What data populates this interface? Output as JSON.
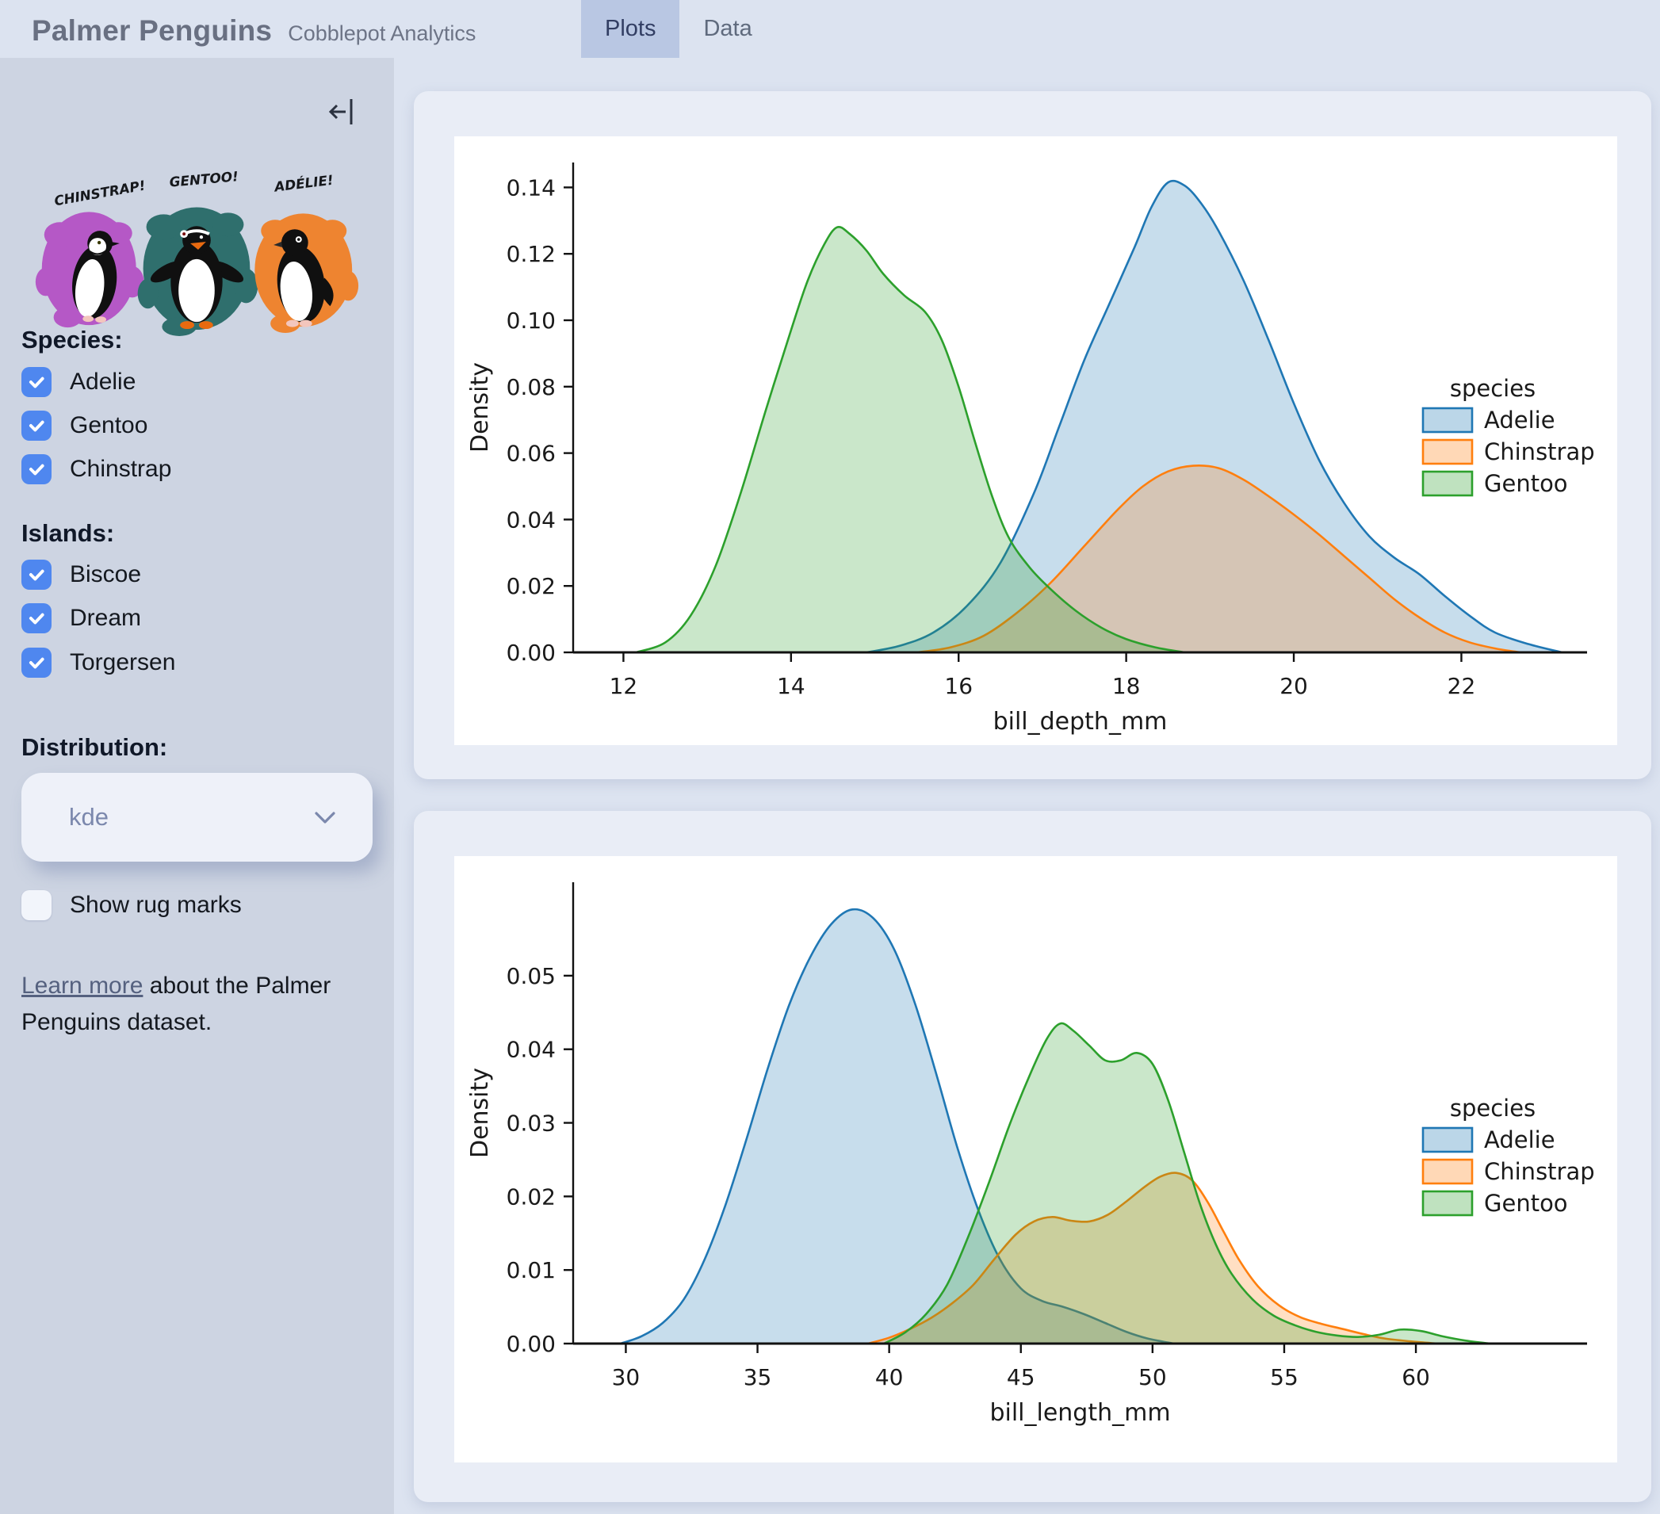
{
  "header": {
    "title": "Palmer Penguins",
    "subtitle": "Cobblepot Analytics",
    "tabs": [
      {
        "label": "Plots",
        "active": true
      },
      {
        "label": "Data",
        "active": false
      }
    ]
  },
  "sidebar": {
    "artwork": {
      "labels": [
        "CHINSTRAP!",
        "GENTOO!",
        "ADÉLIE!"
      ],
      "blob_colors": [
        "#b558c6",
        "#2f6f6d",
        "#ee8430"
      ]
    },
    "species": {
      "heading": "Species:",
      "options": [
        {
          "label": "Adelie",
          "checked": true
        },
        {
          "label": "Gentoo",
          "checked": true
        },
        {
          "label": "Chinstrap",
          "checked": true
        }
      ]
    },
    "islands": {
      "heading": "Islands:",
      "options": [
        {
          "label": "Biscoe",
          "checked": true
        },
        {
          "label": "Dream",
          "checked": true
        },
        {
          "label": "Torgersen",
          "checked": true
        }
      ]
    },
    "distribution": {
      "heading": "Distribution:",
      "value": "kde"
    },
    "rug": {
      "label": "Show rug marks",
      "checked": false
    },
    "footer": {
      "link_text": "Learn more",
      "rest": " about the Palmer Penguins dataset."
    }
  },
  "chart_data": [
    {
      "type": "area",
      "subtype": "kde",
      "xlabel": "bill_depth_mm",
      "ylabel": "Density",
      "xlim": [
        11.4,
        23.5
      ],
      "ylim": [
        0,
        0.1475
      ],
      "xticks": [
        12,
        14,
        16,
        18,
        20,
        22
      ],
      "yticks": [
        0.0,
        0.02,
        0.04,
        0.06,
        0.08,
        0.1,
        0.12,
        0.14
      ],
      "ytick_decimals": 2,
      "grid": false,
      "legend": {
        "title": "species",
        "position": "center-right",
        "entries": [
          {
            "label": "Adelie",
            "color": "#1f77b4"
          },
          {
            "label": "Chinstrap",
            "color": "#ff7f0e"
          },
          {
            "label": "Gentoo",
            "color": "#2ca02c"
          }
        ]
      },
      "series": [
        {
          "name": "Adelie",
          "color": "#1f77b4",
          "points": [
            [
              14.9,
              0
            ],
            [
              15.3,
              0.002
            ],
            [
              15.7,
              0.006
            ],
            [
              16.1,
              0.014
            ],
            [
              16.5,
              0.027
            ],
            [
              16.9,
              0.048
            ],
            [
              17.2,
              0.068
            ],
            [
              17.5,
              0.088
            ],
            [
              17.8,
              0.105
            ],
            [
              18.1,
              0.122
            ],
            [
              18.3,
              0.134
            ],
            [
              18.5,
              0.1415
            ],
            [
              18.7,
              0.1405
            ],
            [
              18.9,
              0.135
            ],
            [
              19.1,
              0.127
            ],
            [
              19.4,
              0.112
            ],
            [
              19.7,
              0.094
            ],
            [
              20.0,
              0.075
            ],
            [
              20.3,
              0.058
            ],
            [
              20.6,
              0.045
            ],
            [
              20.9,
              0.035
            ],
            [
              21.2,
              0.0285
            ],
            [
              21.5,
              0.0235
            ],
            [
              21.8,
              0.017
            ],
            [
              22.1,
              0.011
            ],
            [
              22.4,
              0.006
            ],
            [
              22.8,
              0.0025
            ],
            [
              23.2,
              0
            ]
          ]
        },
        {
          "name": "Chinstrap",
          "color": "#ff7f0e",
          "points": [
            [
              15.5,
              0
            ],
            [
              15.9,
              0.0015
            ],
            [
              16.3,
              0.005
            ],
            [
              16.7,
              0.012
            ],
            [
              17.1,
              0.021
            ],
            [
              17.5,
              0.032
            ],
            [
              17.9,
              0.043
            ],
            [
              18.2,
              0.05
            ],
            [
              18.5,
              0.0545
            ],
            [
              18.8,
              0.0562
            ],
            [
              19.1,
              0.0555
            ],
            [
              19.4,
              0.052
            ],
            [
              19.7,
              0.047
            ],
            [
              20.0,
              0.0415
            ],
            [
              20.3,
              0.0355
            ],
            [
              20.6,
              0.029
            ],
            [
              20.9,
              0.0225
            ],
            [
              21.2,
              0.016
            ],
            [
              21.5,
              0.0105
            ],
            [
              21.8,
              0.006
            ],
            [
              22.1,
              0.003
            ],
            [
              22.4,
              0.0012
            ],
            [
              22.7,
              0
            ]
          ]
        },
        {
          "name": "Gentoo",
          "color": "#2ca02c",
          "points": [
            [
              12.15,
              0
            ],
            [
              12.5,
              0.003
            ],
            [
              12.8,
              0.011
            ],
            [
              13.1,
              0.026
            ],
            [
              13.4,
              0.048
            ],
            [
              13.7,
              0.073
            ],
            [
              14.0,
              0.097
            ],
            [
              14.2,
              0.112
            ],
            [
              14.4,
              0.123
            ],
            [
              14.55,
              0.128
            ],
            [
              14.7,
              0.126
            ],
            [
              14.9,
              0.121
            ],
            [
              15.1,
              0.114
            ],
            [
              15.35,
              0.1075
            ],
            [
              15.6,
              0.1025
            ],
            [
              15.8,
              0.094
            ],
            [
              16.0,
              0.08
            ],
            [
              16.2,
              0.063
            ],
            [
              16.4,
              0.047
            ],
            [
              16.6,
              0.0345
            ],
            [
              16.85,
              0.0255
            ],
            [
              17.1,
              0.019
            ],
            [
              17.4,
              0.0125
            ],
            [
              17.7,
              0.0075
            ],
            [
              18.0,
              0.004
            ],
            [
              18.35,
              0.0015
            ],
            [
              18.7,
              0
            ]
          ]
        }
      ]
    },
    {
      "type": "area",
      "subtype": "kde",
      "xlabel": "bill_length_mm",
      "ylabel": "Density",
      "xlim": [
        28.0,
        66.5
      ],
      "ylim": [
        0,
        0.0627
      ],
      "xticks": [
        30,
        35,
        40,
        45,
        50,
        55,
        60
      ],
      "yticks": [
        0.0,
        0.01,
        0.02,
        0.03,
        0.04,
        0.05
      ],
      "ytick_decimals": 2,
      "grid": false,
      "legend": {
        "title": "species",
        "position": "center-right",
        "entries": [
          {
            "label": "Adelie",
            "color": "#1f77b4"
          },
          {
            "label": "Chinstrap",
            "color": "#ff7f0e"
          },
          {
            "label": "Gentoo",
            "color": "#2ca02c"
          }
        ]
      },
      "series": [
        {
          "name": "Adelie",
          "color": "#1f77b4",
          "points": [
            [
              29.8,
              0
            ],
            [
              30.6,
              0.001
            ],
            [
              31.4,
              0.0028
            ],
            [
              32.2,
              0.006
            ],
            [
              33.0,
              0.0115
            ],
            [
              33.8,
              0.019
            ],
            [
              34.6,
              0.028
            ],
            [
              35.4,
              0.0375
            ],
            [
              36.2,
              0.046
            ],
            [
              37.0,
              0.0525
            ],
            [
              37.8,
              0.057
            ],
            [
              38.6,
              0.059
            ],
            [
              39.4,
              0.0578
            ],
            [
              40.2,
              0.0535
            ],
            [
              41.0,
              0.046
            ],
            [
              41.8,
              0.0365
            ],
            [
              42.6,
              0.0265
            ],
            [
              43.4,
              0.018
            ],
            [
              44.2,
              0.0115
            ],
            [
              45.0,
              0.0075
            ],
            [
              45.8,
              0.0058
            ],
            [
              46.6,
              0.005
            ],
            [
              47.4,
              0.004
            ],
            [
              48.2,
              0.0028
            ],
            [
              49.0,
              0.0016
            ],
            [
              49.8,
              0.0007
            ],
            [
              50.8,
              0
            ]
          ]
        },
        {
          "name": "Chinstrap",
          "color": "#ff7f0e",
          "points": [
            [
              39.2,
              0
            ],
            [
              40.0,
              0.0008
            ],
            [
              40.8,
              0.002
            ],
            [
              41.6,
              0.0035
            ],
            [
              42.4,
              0.0055
            ],
            [
              43.2,
              0.008
            ],
            [
              44.0,
              0.0115
            ],
            [
              44.8,
              0.0148
            ],
            [
              45.5,
              0.0166
            ],
            [
              46.2,
              0.0172
            ],
            [
              46.9,
              0.0167
            ],
            [
              47.6,
              0.0166
            ],
            [
              48.3,
              0.0175
            ],
            [
              49.0,
              0.0193
            ],
            [
              49.7,
              0.0213
            ],
            [
              50.3,
              0.0227
            ],
            [
              50.9,
              0.0232
            ],
            [
              51.5,
              0.0222
            ],
            [
              52.1,
              0.0192
            ],
            [
              52.7,
              0.0152
            ],
            [
              53.3,
              0.0113
            ],
            [
              54.0,
              0.0078
            ],
            [
              54.8,
              0.0052
            ],
            [
              55.6,
              0.0036
            ],
            [
              56.4,
              0.0027
            ],
            [
              57.2,
              0.002
            ],
            [
              58.0,
              0.0013
            ],
            [
              58.8,
              0.0007
            ],
            [
              59.8,
              0.0003
            ],
            [
              60.8,
              0
            ]
          ]
        },
        {
          "name": "Gentoo",
          "color": "#2ca02c",
          "points": [
            [
              39.8,
              0
            ],
            [
              40.6,
              0.0015
            ],
            [
              41.4,
              0.004
            ],
            [
              42.2,
              0.008
            ],
            [
              43.0,
              0.0145
            ],
            [
              43.8,
              0.022
            ],
            [
              44.6,
              0.03
            ],
            [
              45.4,
              0.037
            ],
            [
              46.0,
              0.0415
            ],
            [
              46.5,
              0.0435
            ],
            [
              47.0,
              0.0425
            ],
            [
              47.6,
              0.0405
            ],
            [
              48.2,
              0.0385
            ],
            [
              48.8,
              0.0385
            ],
            [
              49.4,
              0.0395
            ],
            [
              50.0,
              0.038
            ],
            [
              50.6,
              0.033
            ],
            [
              51.2,
              0.026
            ],
            [
              51.8,
              0.019
            ],
            [
              52.4,
              0.0135
            ],
            [
              53.0,
              0.0095
            ],
            [
              53.8,
              0.006
            ],
            [
              54.6,
              0.0038
            ],
            [
              55.4,
              0.0025
            ],
            [
              56.2,
              0.0016
            ],
            [
              57.0,
              0.0011
            ],
            [
              57.8,
              0.0009
            ],
            [
              58.6,
              0.0012
            ],
            [
              59.4,
              0.0019
            ],
            [
              60.2,
              0.0017
            ],
            [
              61.0,
              0.001
            ],
            [
              61.9,
              0.0004
            ],
            [
              62.8,
              0
            ]
          ]
        }
      ]
    }
  ]
}
